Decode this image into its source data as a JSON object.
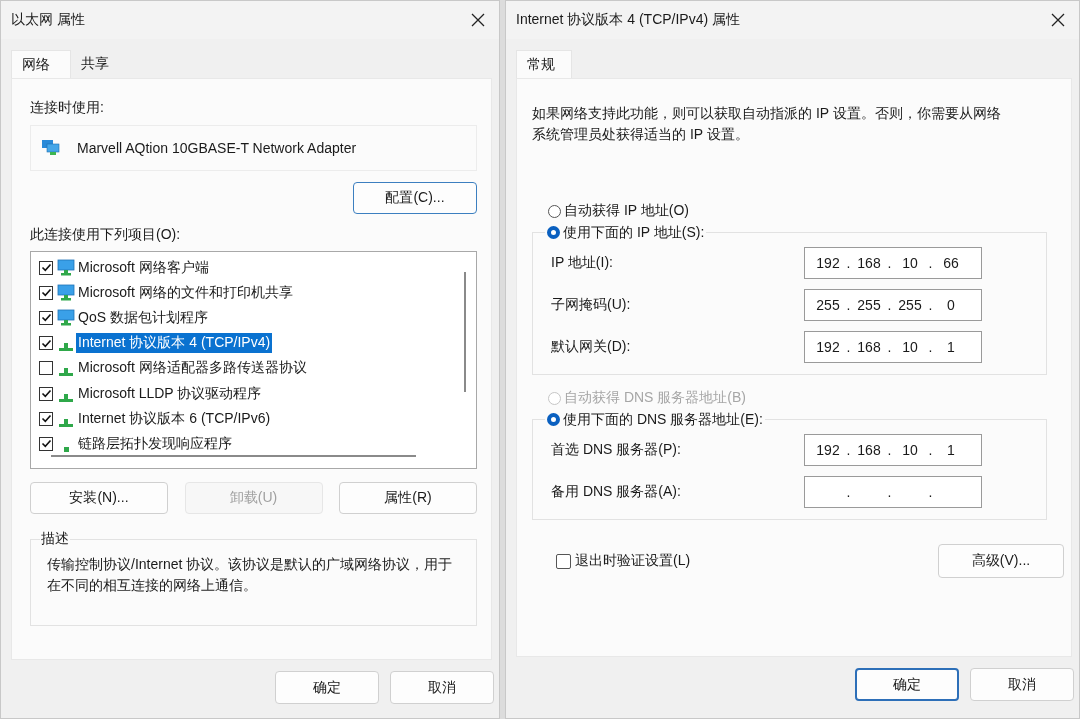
{
  "left_window": {
    "title": "以太网 属性",
    "tabs": [
      {
        "label": "网络",
        "selected": true
      },
      {
        "label": "共享",
        "selected": false
      }
    ],
    "connect_using_label": "连接时使用:",
    "adapter": "Marvell AQtion 10GBASE-T Network Adapter",
    "configure_button": "配置(C)...",
    "items_label": "此连接使用下列项目(O):",
    "items": [
      {
        "label": "Microsoft 网络客户端",
        "checked": true,
        "selected": false,
        "kind": "monitor"
      },
      {
        "label": "Microsoft 网络的文件和打印机共享",
        "checked": true,
        "selected": false,
        "kind": "monitor"
      },
      {
        "label": "QoS 数据包计划程序",
        "checked": true,
        "selected": false,
        "kind": "monitor"
      },
      {
        "label": "Internet 协议版本 4 (TCP/IPv4)",
        "checked": true,
        "selected": true,
        "kind": "protocol"
      },
      {
        "label": "Microsoft 网络适配器多路传送器协议",
        "checked": false,
        "selected": false,
        "kind": "protocol"
      },
      {
        "label": "Microsoft LLDP 协议驱动程序",
        "checked": true,
        "selected": false,
        "kind": "protocol"
      },
      {
        "label": "Internet 协议版本 6 (TCP/IPv6)",
        "checked": true,
        "selected": false,
        "kind": "protocol"
      },
      {
        "label": "链路层拓扑发现响应程序",
        "checked": true,
        "selected": false,
        "kind": "dot"
      }
    ],
    "buttons": [
      {
        "label": "安装(N)...",
        "disabled": false
      },
      {
        "label": "卸载(U)",
        "disabled": true
      },
      {
        "label": "属性(R)",
        "disabled": false
      }
    ],
    "description": {
      "legend": "描述",
      "text": "传输控制协议/Internet 协议。该协议是默认的广域网络协议，用于在不同的相互连接的网络上通信。"
    },
    "footer_buttons": [
      {
        "label": "确定",
        "default": false
      },
      {
        "label": "取消",
        "default": false
      }
    ]
  },
  "right_window": {
    "title": "Internet 协议版本 4 (TCP/IPv4) 属性",
    "tabs": [
      {
        "label": "常规",
        "selected": true
      }
    ],
    "intro": "如果网络支持此功能，则可以获取自动指派的 IP 设置。否则，你需要从网络系统管理员处获得适当的 IP 设置。",
    "ip_options": [
      {
        "label": "自动获得 IP 地址(O)",
        "selected": false,
        "disabled": false
      },
      {
        "label": "使用下面的 IP 地址(S):",
        "selected": true,
        "disabled": false
      }
    ],
    "ip_fields": [
      {
        "label": "IP 地址(I):",
        "octets": [
          "192",
          "168",
          "10",
          "66"
        ],
        "separators": [
          ".",
          ".",
          "."
        ]
      },
      {
        "label": "子网掩码(U):",
        "octets": [
          "255",
          "255",
          "255",
          "0"
        ],
        "separators": [
          ".",
          ".",
          "."
        ]
      },
      {
        "label": "默认网关(D):",
        "octets": [
          "192",
          "168",
          "10",
          "1"
        ],
        "separators": [
          ".",
          ".",
          "."
        ]
      }
    ],
    "dns_options": [
      {
        "label": "自动获得 DNS 服务器地址(B)",
        "selected": false,
        "disabled": true
      },
      {
        "label": "使用下面的 DNS 服务器地址(E):",
        "selected": true,
        "disabled": false
      }
    ],
    "dns_fields": [
      {
        "label": "首选 DNS 服务器(P):",
        "octets": [
          "192",
          "168",
          "10",
          "1"
        ],
        "separators": [
          ".",
          ".",
          "."
        ]
      },
      {
        "label": "备用 DNS 服务器(A):",
        "separators": [
          ".",
          ".",
          "."
        ]
      }
    ],
    "validate": {
      "label": "退出时验证设置(L)",
      "checked": false
    },
    "advanced_button": "高级(V)...",
    "footer_buttons": [
      {
        "label": "确定",
        "default": true
      },
      {
        "label": "取消",
        "default": false
      }
    ]
  }
}
